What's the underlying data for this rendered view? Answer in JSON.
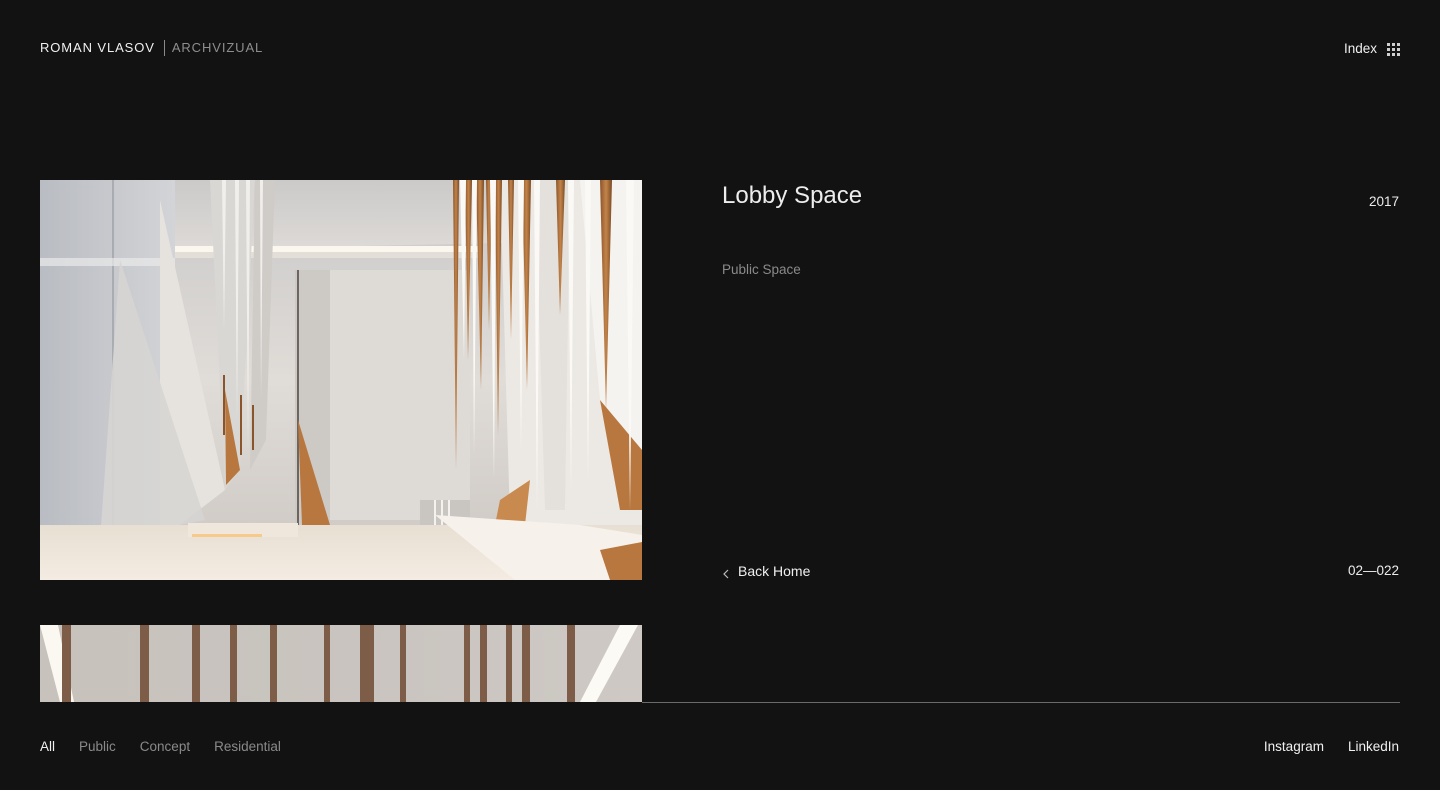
{
  "header": {
    "brand_name": "ROMAN VLASOV",
    "brand_sub": "ARCHVIZUAL",
    "index_label": "Index",
    "index_icon": "grid-icon"
  },
  "project": {
    "title": "Lobby Space",
    "year": "2017",
    "category": "Public Space",
    "back_label": "Back Home",
    "back_icon": "chevron-left-icon",
    "counter": "02—022"
  },
  "footer": {
    "filters": [
      {
        "label": "All",
        "active": true
      },
      {
        "label": "Public",
        "active": false
      },
      {
        "label": "Concept",
        "active": false
      },
      {
        "label": "Residential",
        "active": false
      }
    ],
    "social": [
      "Instagram",
      "LinkedIn"
    ]
  },
  "colors": {
    "background": "#121212",
    "text_primary": "#f0f0f0",
    "text_muted": "#8a8a8a",
    "accent_copper": "#b8773f"
  }
}
